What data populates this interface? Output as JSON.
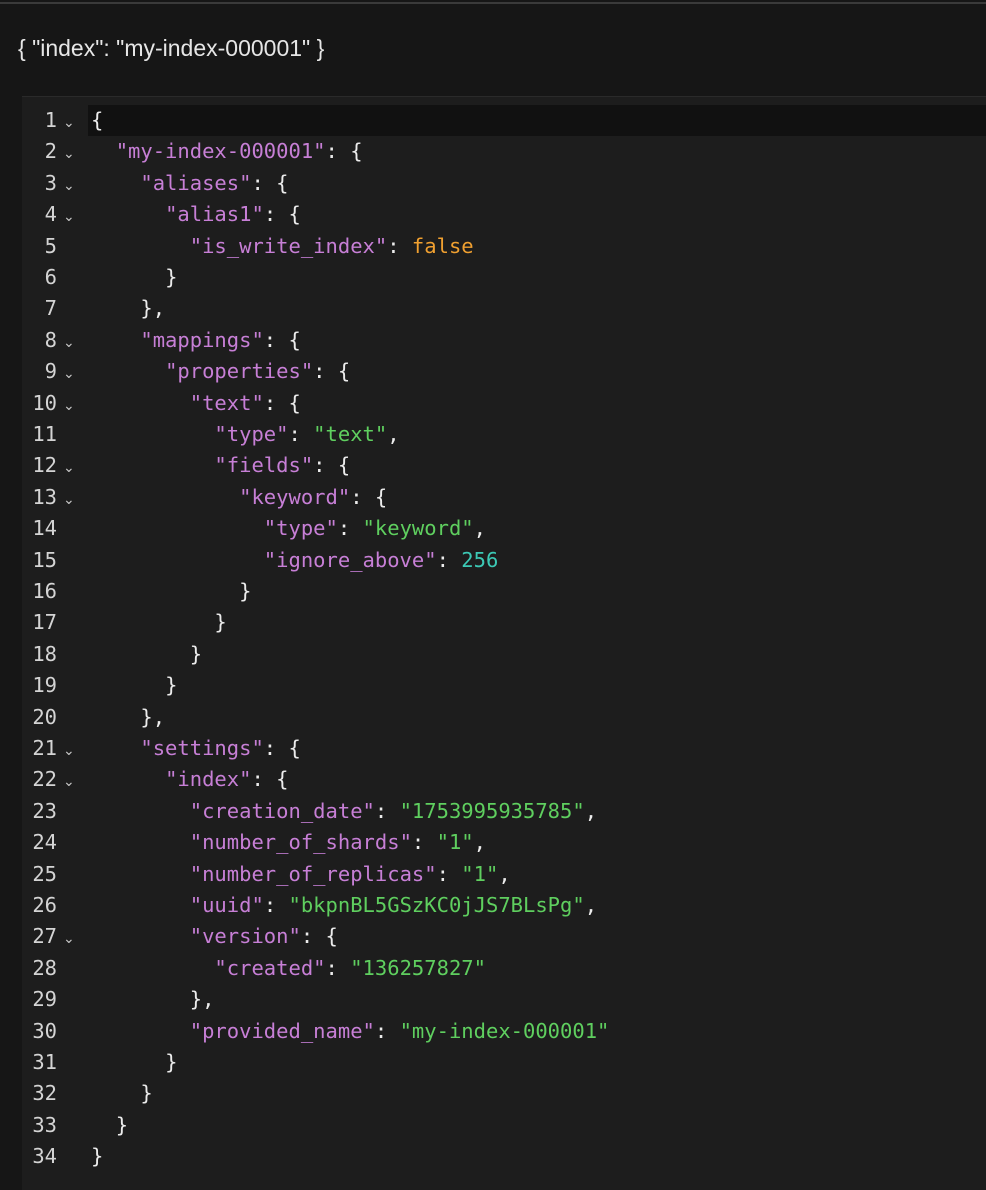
{
  "request": {
    "text": "{ \"index\": \"my-index-000001\" }"
  },
  "editor": {
    "active_line": 1,
    "lines": [
      {
        "n": "1",
        "fold": true,
        "indent": 0,
        "tokens": [
          [
            "p",
            "{"
          ]
        ]
      },
      {
        "n": "2",
        "fold": true,
        "indent": 1,
        "tokens": [
          [
            "k",
            "\"my-index-000001\""
          ],
          [
            "p",
            ": {"
          ]
        ]
      },
      {
        "n": "3",
        "fold": true,
        "indent": 2,
        "tokens": [
          [
            "k",
            "\"aliases\""
          ],
          [
            "p",
            ": {"
          ]
        ]
      },
      {
        "n": "4",
        "fold": true,
        "indent": 3,
        "tokens": [
          [
            "k",
            "\"alias1\""
          ],
          [
            "p",
            ": {"
          ]
        ]
      },
      {
        "n": "5",
        "fold": false,
        "indent": 4,
        "tokens": [
          [
            "k",
            "\"is_write_index\""
          ],
          [
            "p",
            ": "
          ],
          [
            "b",
            "false"
          ]
        ]
      },
      {
        "n": "6",
        "fold": false,
        "indent": 3,
        "tokens": [
          [
            "p",
            "}"
          ]
        ]
      },
      {
        "n": "7",
        "fold": false,
        "indent": 2,
        "tokens": [
          [
            "p",
            "},"
          ]
        ]
      },
      {
        "n": "8",
        "fold": true,
        "indent": 2,
        "tokens": [
          [
            "k",
            "\"mappings\""
          ],
          [
            "p",
            ": {"
          ]
        ]
      },
      {
        "n": "9",
        "fold": true,
        "indent": 3,
        "tokens": [
          [
            "k",
            "\"properties\""
          ],
          [
            "p",
            ": {"
          ]
        ]
      },
      {
        "n": "10",
        "fold": true,
        "indent": 4,
        "tokens": [
          [
            "k",
            "\"text\""
          ],
          [
            "p",
            ": {"
          ]
        ]
      },
      {
        "n": "11",
        "fold": false,
        "indent": 5,
        "tokens": [
          [
            "k",
            "\"type\""
          ],
          [
            "p",
            ": "
          ],
          [
            "s",
            "\"text\""
          ],
          [
            "p",
            ","
          ]
        ]
      },
      {
        "n": "12",
        "fold": true,
        "indent": 5,
        "tokens": [
          [
            "k",
            "\"fields\""
          ],
          [
            "p",
            ": {"
          ]
        ]
      },
      {
        "n": "13",
        "fold": true,
        "indent": 6,
        "tokens": [
          [
            "k",
            "\"keyword\""
          ],
          [
            "p",
            ": {"
          ]
        ]
      },
      {
        "n": "14",
        "fold": false,
        "indent": 7,
        "tokens": [
          [
            "k",
            "\"type\""
          ],
          [
            "p",
            ": "
          ],
          [
            "s",
            "\"keyword\""
          ],
          [
            "p",
            ","
          ]
        ]
      },
      {
        "n": "15",
        "fold": false,
        "indent": 7,
        "tokens": [
          [
            "k",
            "\"ignore_above\""
          ],
          [
            "p",
            ": "
          ],
          [
            "n",
            "256"
          ]
        ]
      },
      {
        "n": "16",
        "fold": false,
        "indent": 6,
        "tokens": [
          [
            "p",
            "}"
          ]
        ]
      },
      {
        "n": "17",
        "fold": false,
        "indent": 5,
        "tokens": [
          [
            "p",
            "}"
          ]
        ]
      },
      {
        "n": "18",
        "fold": false,
        "indent": 4,
        "tokens": [
          [
            "p",
            "}"
          ]
        ]
      },
      {
        "n": "19",
        "fold": false,
        "indent": 3,
        "tokens": [
          [
            "p",
            "}"
          ]
        ]
      },
      {
        "n": "20",
        "fold": false,
        "indent": 2,
        "tokens": [
          [
            "p",
            "},"
          ]
        ]
      },
      {
        "n": "21",
        "fold": true,
        "indent": 2,
        "tokens": [
          [
            "k",
            "\"settings\""
          ],
          [
            "p",
            ": {"
          ]
        ]
      },
      {
        "n": "22",
        "fold": true,
        "indent": 3,
        "tokens": [
          [
            "k",
            "\"index\""
          ],
          [
            "p",
            ": {"
          ]
        ]
      },
      {
        "n": "23",
        "fold": false,
        "indent": 4,
        "tokens": [
          [
            "k",
            "\"creation_date\""
          ],
          [
            "p",
            ": "
          ],
          [
            "s",
            "\"1753995935785\""
          ],
          [
            "p",
            ","
          ]
        ]
      },
      {
        "n": "24",
        "fold": false,
        "indent": 4,
        "tokens": [
          [
            "k",
            "\"number_of_shards\""
          ],
          [
            "p",
            ": "
          ],
          [
            "s",
            "\"1\""
          ],
          [
            "p",
            ","
          ]
        ]
      },
      {
        "n": "25",
        "fold": false,
        "indent": 4,
        "tokens": [
          [
            "k",
            "\"number_of_replicas\""
          ],
          [
            "p",
            ": "
          ],
          [
            "s",
            "\"1\""
          ],
          [
            "p",
            ","
          ]
        ]
      },
      {
        "n": "26",
        "fold": false,
        "indent": 4,
        "tokens": [
          [
            "k",
            "\"uuid\""
          ],
          [
            "p",
            ": "
          ],
          [
            "s",
            "\"bkpnBL5GSzKC0jJS7BLsPg\""
          ],
          [
            "p",
            ","
          ]
        ]
      },
      {
        "n": "27",
        "fold": true,
        "indent": 4,
        "tokens": [
          [
            "k",
            "\"version\""
          ],
          [
            "p",
            ": {"
          ]
        ]
      },
      {
        "n": "28",
        "fold": false,
        "indent": 5,
        "tokens": [
          [
            "k",
            "\"created\""
          ],
          [
            "p",
            ": "
          ],
          [
            "s",
            "\"136257827\""
          ]
        ]
      },
      {
        "n": "29",
        "fold": false,
        "indent": 4,
        "tokens": [
          [
            "p",
            "},"
          ]
        ]
      },
      {
        "n": "30",
        "fold": false,
        "indent": 4,
        "tokens": [
          [
            "k",
            "\"provided_name\""
          ],
          [
            "p",
            ": "
          ],
          [
            "s",
            "\"my-index-000001\""
          ]
        ]
      },
      {
        "n": "31",
        "fold": false,
        "indent": 3,
        "tokens": [
          [
            "p",
            "}"
          ]
        ]
      },
      {
        "n": "32",
        "fold": false,
        "indent": 2,
        "tokens": [
          [
            "p",
            "}"
          ]
        ]
      },
      {
        "n": "33",
        "fold": false,
        "indent": 1,
        "tokens": [
          [
            "p",
            "}"
          ]
        ]
      },
      {
        "n": "34",
        "fold": false,
        "indent": 0,
        "tokens": [
          [
            "p",
            "}"
          ]
        ]
      }
    ],
    "fold_icon": "chevron-down-icon"
  }
}
